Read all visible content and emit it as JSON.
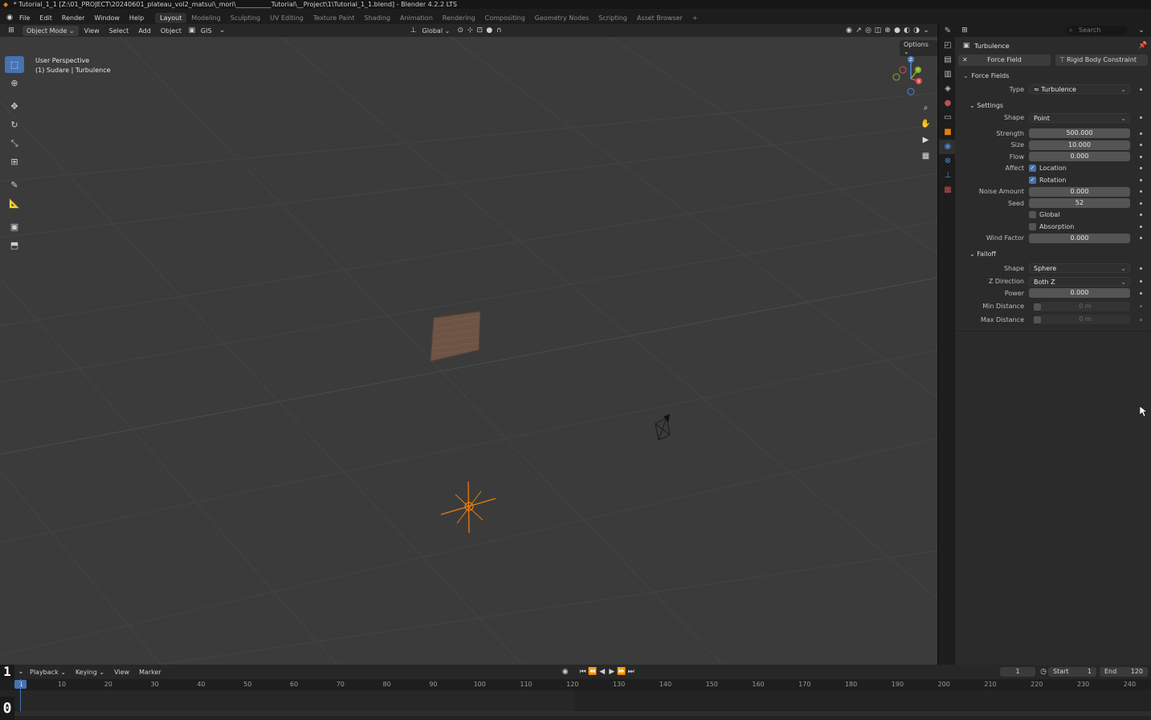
{
  "window": {
    "title": "* Tutorial_1_1 [Z:\\01_PROJECT\\20240601_plateau_vol2_matsui\\_mori\\___________Tutorial\\__Project\\1\\Tutorial_1_1.blend] - Blender 4.2.2 LTS"
  },
  "menu": [
    "File",
    "Edit",
    "Render",
    "Window",
    "Help"
  ],
  "workspaces": [
    "Layout",
    "Modeling",
    "Sculpting",
    "UV Editing",
    "Texture Paint",
    "Shading",
    "Animation",
    "Rendering",
    "Compositing",
    "Geometry Nodes",
    "Scripting",
    "Asset Browser"
  ],
  "active_workspace": "Layout",
  "viewport_header": {
    "mode": "Object Mode",
    "menus": [
      "View",
      "Select",
      "Add",
      "Object"
    ],
    "gis": "GIS",
    "orientation": "Global",
    "options": "Options"
  },
  "viewport": {
    "perspective": "User Perspective",
    "object_info": "(1) Sudare | Turbulence",
    "gizmo_axes": [
      "X",
      "Y",
      "Z"
    ]
  },
  "properties": {
    "search_placeholder": "Search",
    "object_name": "Turbulence",
    "force_field_button": "Force Field",
    "rigid_body_button": "Rigid Body Constraint",
    "force_fields_title": "Force Fields",
    "type_label": "Type",
    "type_value": "Turbulence",
    "settings_title": "Settings",
    "settings": {
      "shape_label": "Shape",
      "shape_value": "Point",
      "strength_label": "Strength",
      "strength_value": "500.000",
      "size_label": "Size",
      "size_value": "10.000",
      "flow_label": "Flow",
      "flow_value": "0.000",
      "affect_label": "Affect",
      "location_label": "Location",
      "location_checked": true,
      "rotation_label": "Rotation",
      "rotation_checked": true,
      "noise_label": "Noise Amount",
      "noise_value": "0.000",
      "seed_label": "Seed",
      "seed_value": "52",
      "global_label": "Global",
      "global_checked": false,
      "absorption_label": "Absorption",
      "absorption_checked": false,
      "wind_label": "Wind Factor",
      "wind_value": "0.000"
    },
    "falloff_title": "Falloff",
    "falloff": {
      "shape_label": "Shape",
      "shape_value": "Sphere",
      "zdir_label": "Z Direction",
      "zdir_value": "Both Z",
      "power_label": "Power",
      "power_value": "0.000",
      "min_label": "Min Distance",
      "min_value": "0 m",
      "max_label": "Max Distance",
      "max_value": "0 m"
    }
  },
  "timeline": {
    "menus": [
      "Playback",
      "Keying",
      "View",
      "Marker"
    ],
    "current_frame": "1",
    "start_label": "Start",
    "start_value": "1",
    "end_label": "End",
    "end_value": "120",
    "ruler": [
      "1",
      "10",
      "20",
      "30",
      "40",
      "50",
      "60",
      "70",
      "80",
      "90",
      "100",
      "110",
      "120",
      "130",
      "140",
      "150",
      "160",
      "170",
      "180",
      "190",
      "200",
      "210",
      "220",
      "230",
      "240"
    ],
    "left_top_digit": "1",
    "left_bottom_digit": "0"
  },
  "colors": {
    "accent": "#4772b3",
    "selected_object": "#e87d0d",
    "viewport_bg": "#3b3b3b"
  }
}
